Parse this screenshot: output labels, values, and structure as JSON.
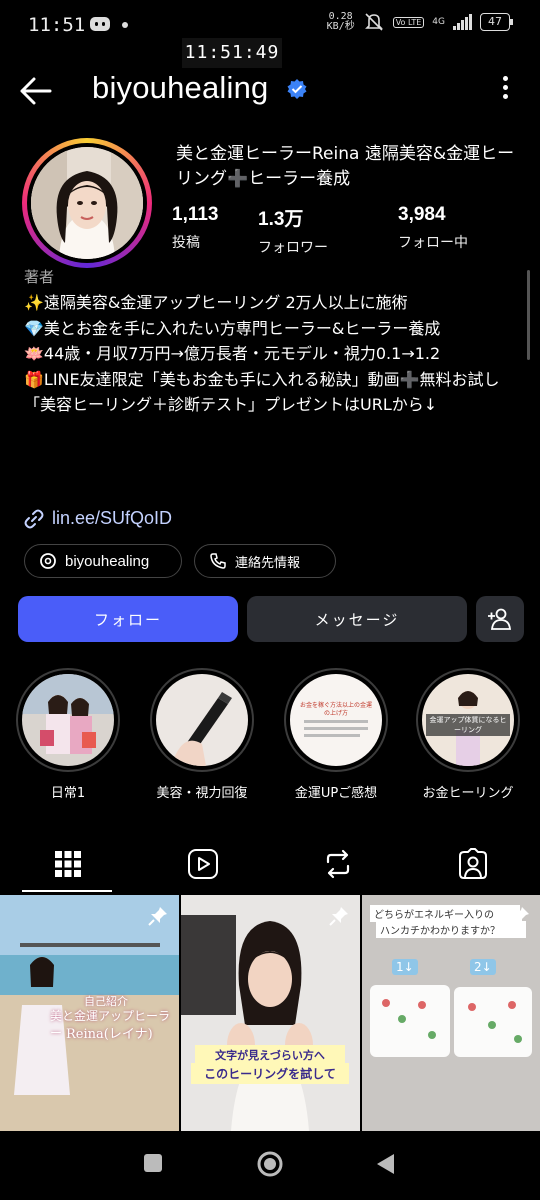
{
  "status_bar": {
    "time": "11:51",
    "overlay_clock": "11:51:49",
    "net_speed_value": "0.28",
    "net_speed_unit": "KB/秒",
    "volte": "Vo LTE",
    "signal": "4G",
    "battery": "47"
  },
  "header": {
    "username": "biyouhealing",
    "back_icon": "arrow-left-icon",
    "verified_icon": "verified-badge-icon",
    "more_icon": "more-vertical-icon"
  },
  "profile": {
    "display_name": "美と金運ヒーラーReina 遠隔美容&金運ヒーリング➕ヒーラー養成",
    "stats": [
      {
        "value": "1,113",
        "label": "投稿"
      },
      {
        "value": "1.3万",
        "label": "フォロワー"
      },
      {
        "value": "3,984",
        "label": "フォロー中"
      }
    ],
    "category": "著者",
    "bio_lines": [
      "✨遠隔美容&金運アップヒーリング 2万人以上に施術",
      "💎美とお金を手に入れたい方専門ヒーラー&ヒーラー養成",
      "🪷44歳・月収7万円→億万長者・元モデル・視力0.1→1.2",
      "🎁LINE友達限定「美もお金も手に入れる秘訣」動画➕無料お試し「美容ヒーリング＋診断テスト」プレゼントはURLから↓"
    ],
    "link": "lin.ee/SUfQoID",
    "threads_chip": "biyouhealing",
    "contact_chip": "連絡先情報"
  },
  "actions": {
    "follow": "フォロー",
    "message": "メッセージ",
    "add_user_icon": "add-person-icon"
  },
  "highlights": [
    {
      "label": "日常1"
    },
    {
      "label": "美容・視力回復"
    },
    {
      "label": "金運UPご感想"
    },
    {
      "label": "お金ヒーリング"
    }
  ],
  "highlight_texts": {
    "h3_text": "お金を稼ぐ方法以上の金運の上げ方",
    "h4_text": "金運アップ体質になるヒーリング"
  },
  "tabs": [
    {
      "name": "grid-icon"
    },
    {
      "name": "reels-icon"
    },
    {
      "name": "reposts-icon"
    },
    {
      "name": "tagged-icon"
    }
  ],
  "posts": [
    {
      "line1": "自己紹介",
      "line2": "美と金運アップヒーラー",
      "line3": "Reina(レイナ)"
    },
    {
      "line1": "文字が見えづらい方へ",
      "line2": "このヒーリングを試して"
    },
    {
      "line1": "どちらがエネルギー入りの",
      "line2": "ハンカチかわかりますか？",
      "label1": "1↓",
      "label2": "2↓"
    }
  ],
  "colors": {
    "follow_button": "#4a5df9",
    "secondary_button": "#2b2d33",
    "link": "#c4d2ff",
    "verified": "#3b82f6"
  }
}
